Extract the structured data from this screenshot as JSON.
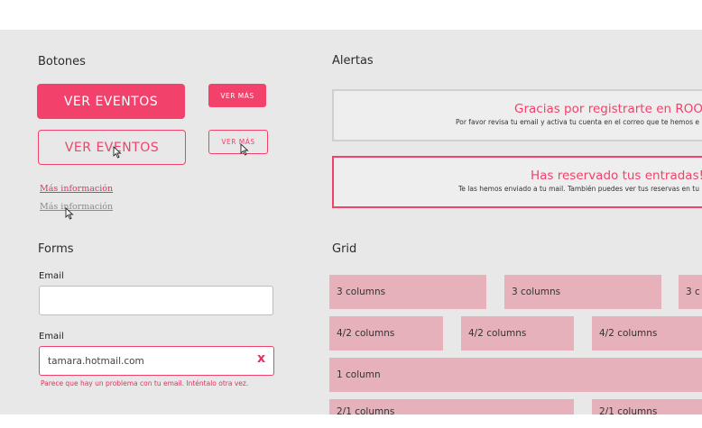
{
  "buttons": {
    "heading": "Botones",
    "large_filled": "VER EVENTOS",
    "large_outline": "VER EVENTOS",
    "small_filled": "VER MÁS",
    "small_outline": "VER MÁS",
    "link_active": "Más información",
    "link_hover": "Más información"
  },
  "alerts": {
    "heading": "Alertas",
    "success_title": "Gracias por registrarte en ROOOF.",
    "success_text": "Por favor revisa tu email y activa tu cuenta en el correo que te hemos e",
    "info_title": "Has reservado tus entradas!",
    "info_text": "Te las hemos enviado a tu mail. También puedes ver tus reservas en tu"
  },
  "forms": {
    "heading": "Forms",
    "email_label": "Email",
    "email_value": "",
    "email_error_label": "Email",
    "email_error_value": "tamara.hotmail.com",
    "clear_glyph": "x",
    "error_text": "Parece que hay un problema con tu email. Inténtalo otra vez."
  },
  "grid": {
    "heading": "Grid",
    "rows": [
      [
        "3 columns",
        "3 columns",
        "3 c"
      ],
      [
        "4/2 columns",
        "4/2 columns",
        "4/2 columns"
      ],
      [
        "1 column"
      ],
      [
        "2/1 columns",
        "2/1 columns"
      ]
    ]
  },
  "colors": {
    "accent": "#f2416b",
    "panel_bg": "#e8e8e8",
    "grid_cell": "#e6b1ba",
    "muted_link": "#8a8a8a"
  },
  "icons": [
    "cursor-arrow-icon"
  ]
}
